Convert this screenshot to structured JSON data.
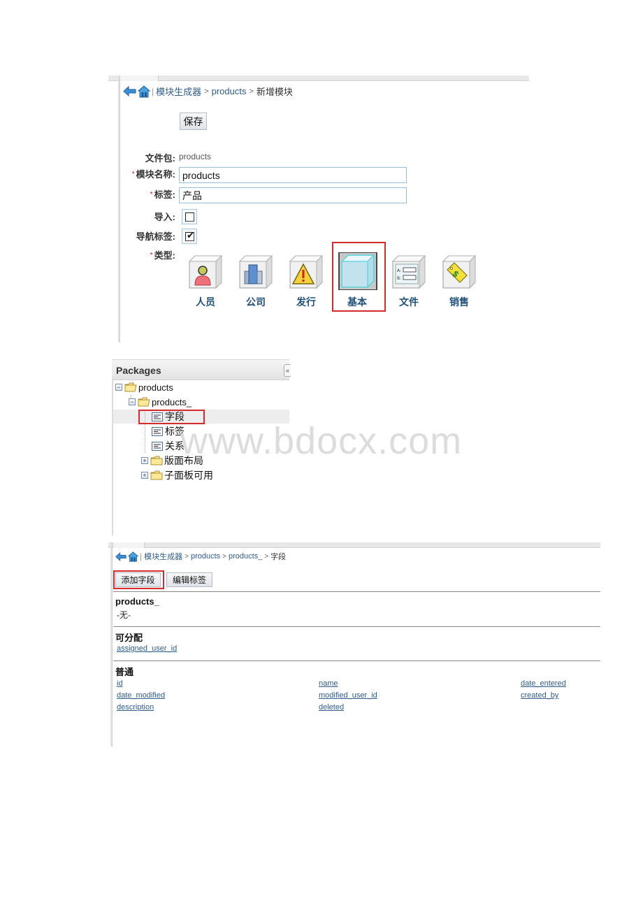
{
  "colors": {
    "link": "#2f5c8a",
    "highlight_border": "#d62b2b",
    "input_border": "#98c0de",
    "type_label": "#1f4f7a",
    "required": "#d01010"
  },
  "panel1": {
    "breadcrumb": {
      "back_icon": "back-arrow-icon",
      "home_icon": "home-icon",
      "separator": "|",
      "items": [
        {
          "label": "模块生成器",
          "link": true
        },
        {
          "label": "products",
          "link": true
        },
        {
          "label": "新增模块",
          "link": false
        }
      ],
      "gt": ">"
    },
    "save_label": "保存",
    "form": {
      "package_label": "文件包:",
      "package_value": "products",
      "module_name_label": "模块名称:",
      "module_name_value": "products",
      "tag_label": "标签:",
      "tag_value": "产品",
      "import_label": "导入:",
      "import_checked": false,
      "nav_tab_label": "导航标签:",
      "nav_tab_checked": true,
      "type_label": "类型:",
      "required_mark": "*",
      "check_mark": "✔"
    },
    "types": [
      {
        "label": "人员",
        "icon": "person-cube-icon",
        "selected": false
      },
      {
        "label": "公司",
        "icon": "company-building-cube-icon",
        "selected": false
      },
      {
        "label": "发行",
        "icon": "warning-cube-icon",
        "selected": false
      },
      {
        "label": "基本",
        "icon": "basic-cube-icon",
        "selected": true
      },
      {
        "label": "文件",
        "icon": "file-form-cube-icon",
        "selected": false
      },
      {
        "label": "销售",
        "icon": "sale-tag-cube-icon",
        "selected": false
      }
    ]
  },
  "panel2": {
    "title": "Packages",
    "collapse_glyph": "«",
    "tree": [
      {
        "label": "products",
        "level": 0,
        "kind": "folder-open",
        "toggle": "−"
      },
      {
        "label": "products_",
        "level": 1,
        "kind": "folder-open",
        "toggle": "−"
      },
      {
        "label": "字段",
        "level": 2,
        "kind": "leaf",
        "selected": true
      },
      {
        "label": "标签",
        "level": 2,
        "kind": "leaf"
      },
      {
        "label": "关系",
        "level": 2,
        "kind": "leaf"
      },
      {
        "label": "版面布局",
        "level": 2,
        "kind": "folder",
        "toggle": "+"
      },
      {
        "label": "子面板可用",
        "level": 2,
        "kind": "folder",
        "toggle": "+"
      }
    ],
    "watermark": "www.bdocx.com"
  },
  "panel3": {
    "breadcrumb": {
      "items": [
        {
          "label": "模块生成器",
          "link": true
        },
        {
          "label": "products",
          "link": true
        },
        {
          "label": "products_",
          "link": true
        },
        {
          "label": "字段",
          "link": false
        }
      ],
      "separator": "|",
      "gt": ">"
    },
    "buttons": {
      "add_field": "添加字段",
      "edit_labels": "编辑标签"
    },
    "sections": [
      {
        "title": "products_",
        "note": "-无-",
        "fields": []
      },
      {
        "title": "可分配",
        "fields": [
          "assigned_user_id"
        ]
      },
      {
        "title": "普通",
        "fields": [
          [
            "id",
            "name",
            "date_entered"
          ],
          [
            "date_modified",
            "modified_user_id",
            "created_by"
          ],
          [
            "description",
            "deleted"
          ]
        ]
      }
    ]
  }
}
